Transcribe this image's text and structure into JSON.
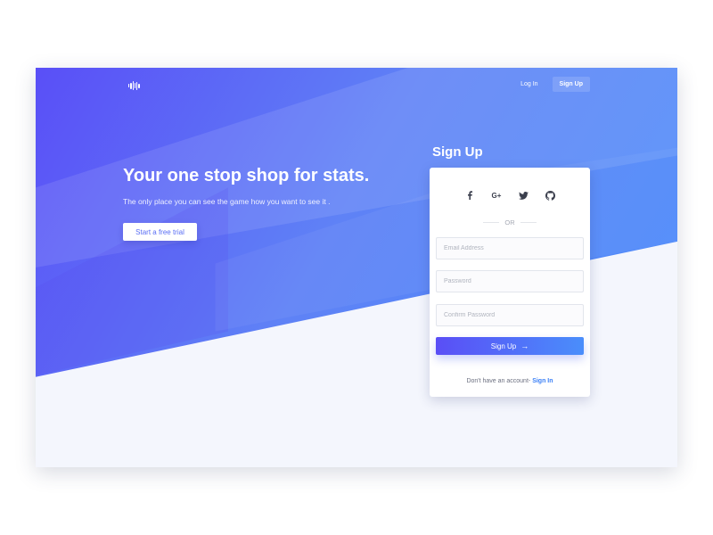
{
  "nav": {
    "logo_icon": "soundwave-logo-icon",
    "login_label": "Log In",
    "signup_label": "Sign Up"
  },
  "hero": {
    "headline": "Your one stop shop for stats.",
    "subline": "The only place you can see the game how you want to see it .",
    "cta_label": "Start a free trial"
  },
  "signup": {
    "title": "Sign Up",
    "social_icons": [
      "facebook-icon",
      "google-plus-icon",
      "twitter-icon",
      "github-icon"
    ],
    "google_glyph": "G+",
    "or_label": "OR",
    "email_placeholder": "Email Address",
    "password_placeholder": "Password",
    "confirm_placeholder": "Confirm Password",
    "submit_label": "Sign Up",
    "submit_arrow": "→",
    "footer_text": "Don't have an account-",
    "footer_link": "Sign In"
  },
  "colors": {
    "gradient_start": "#5a4ff7",
    "gradient_end": "#4a8efb",
    "page_bg": "#f4f6fd",
    "link": "#3a7ff6"
  }
}
